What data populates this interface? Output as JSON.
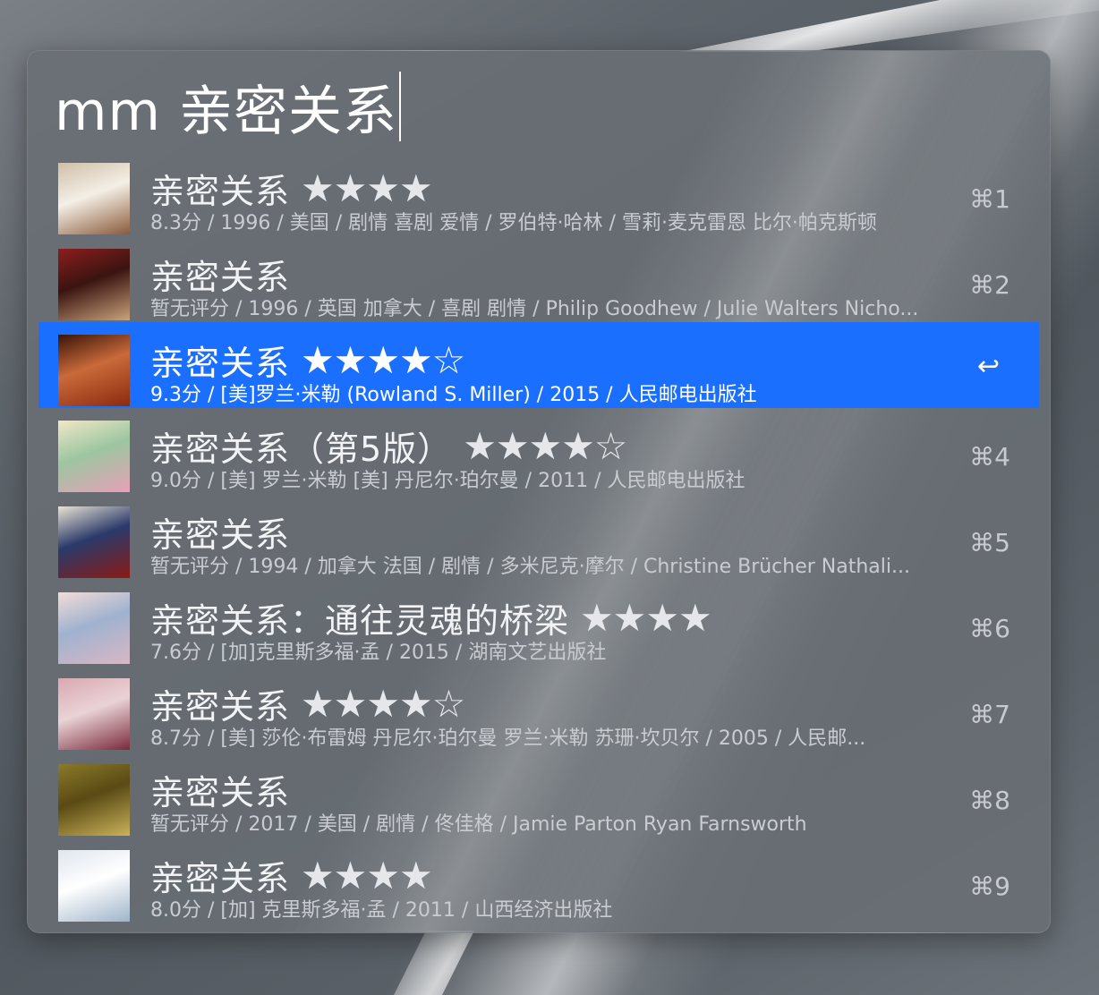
{
  "search": {
    "query": "mm 亲密关系"
  },
  "results": [
    {
      "title": "亲密关系",
      "stars": "★★★★",
      "subtitle": "8.3分 / 1996 / 美国 / 剧情 喜剧 爱情 / 罗伯特·哈林 / 雪莉·麦克雷恩 比尔·帕克斯顿",
      "shortcut": "⌘1",
      "thumb_colors": [
        "#cfbfa8",
        "#8a5a3a",
        "#f4efe6"
      ]
    },
    {
      "title": "亲密关系",
      "stars": "",
      "subtitle": "暂无评分 / 1996 / 英国 加拿大 / 喜剧 剧情 / Philip Goodhew / Julie Walters Nicho...",
      "shortcut": "⌘2",
      "thumb_colors": [
        "#8b1e1e",
        "#c9a27a",
        "#3a1410"
      ]
    },
    {
      "title": "亲密关系",
      "stars": "★★★★☆",
      "subtitle": "9.3分 / [美]罗兰·米勒 (Rowland S. Miller) / 2015 / 人民邮电出版社",
      "shortcut": "↩",
      "selected": true,
      "thumb_colors": [
        "#3a1408",
        "#8a2a10",
        "#c96a3a"
      ]
    },
    {
      "title": "亲密关系（第5版）",
      "stars": "★★★★☆",
      "subtitle": "9.0分 / [美] 罗兰·米勒 [美] 丹尼尔·珀尔曼 / 2011 / 人民邮电出版社",
      "shortcut": "⌘4",
      "thumb_colors": [
        "#f1e7c8",
        "#e7a0b8",
        "#9cc6a0"
      ]
    },
    {
      "title": "亲密关系",
      "stars": "",
      "subtitle": "暂无评分 / 1994 / 加拿大 法国 / 剧情 / 多米尼克·摩尔 / Christine Brücher Nathali...",
      "shortcut": "⌘5",
      "thumb_colors": [
        "#e9e3d4",
        "#8a1a14",
        "#2a3a6a"
      ]
    },
    {
      "title": "亲密关系：通往灵魂的桥梁",
      "stars": "★★★★",
      "subtitle": "7.6分 / [加]克里斯多福·孟 / 2015 / 湖南文艺出版社",
      "shortcut": "⌘6",
      "thumb_colors": [
        "#f3dcd8",
        "#d9b7c4",
        "#9fb2cf"
      ]
    },
    {
      "title": "亲密关系",
      "stars": "★★★★☆",
      "subtitle": "8.7分 / [美] 莎伦·布雷姆 丹尼尔·珀尔曼 罗兰·米勒 苏珊·坎贝尔 / 2005 / 人民邮...",
      "shortcut": "⌘7",
      "thumb_colors": [
        "#d9a8b2",
        "#7a2a3a",
        "#e9d3d6"
      ]
    },
    {
      "title": "亲密关系",
      "stars": "",
      "subtitle": "暂无评分 / 2017 / 美国 / 剧情 / 佟佳格 / Jamie Parton Ryan Farnsworth",
      "shortcut": "⌘8",
      "thumb_colors": [
        "#8a7a2a",
        "#c9b25a",
        "#5a4a14"
      ]
    },
    {
      "title": "亲密关系",
      "stars": "★★★★",
      "subtitle": "8.0分 / [加] 克里斯多福·孟 / 2011 / 山西经济出版社",
      "shortcut": "⌘9",
      "thumb_colors": [
        "#dfe6ee",
        "#9fb4c9",
        "#ffffff"
      ]
    }
  ]
}
